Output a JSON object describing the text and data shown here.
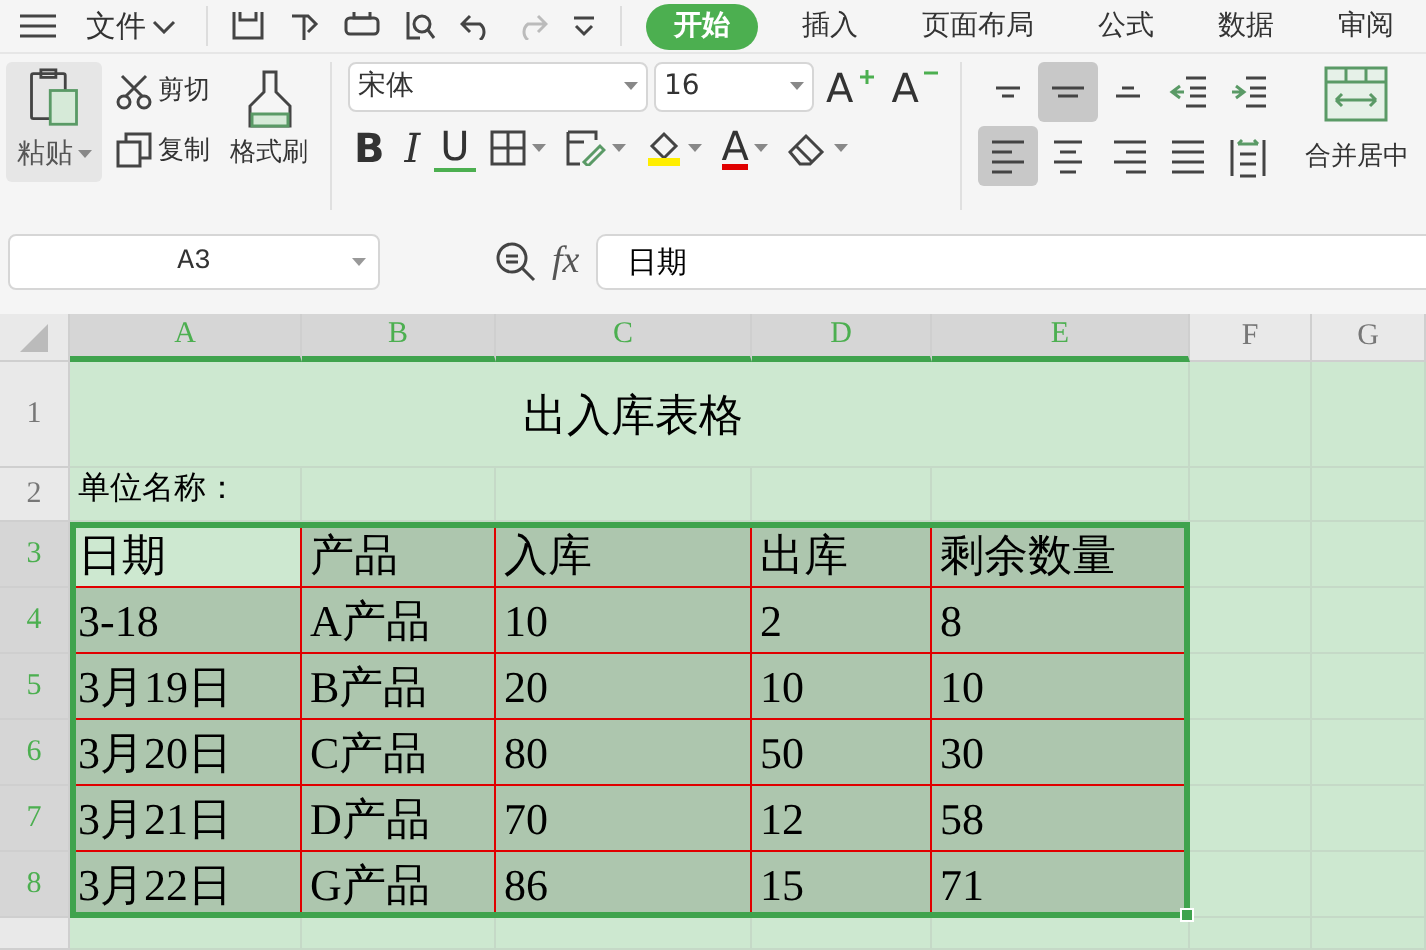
{
  "menu_bar": {
    "file_menu": "文件",
    "tabs": [
      {
        "label": "开始",
        "selected": true
      },
      {
        "label": "插入",
        "selected": false
      },
      {
        "label": "页面布局",
        "selected": false
      },
      {
        "label": "公式",
        "selected": false
      },
      {
        "label": "数据",
        "selected": false
      },
      {
        "label": "审阅",
        "selected": false
      }
    ]
  },
  "ribbon": {
    "paste": "粘贴",
    "cut": "剪切",
    "copy": "复制",
    "format_painter": "格式刷",
    "font_name": "宋体",
    "font_size": "16",
    "grow_font": "A",
    "shrink_font": "A",
    "bold": "B",
    "italic": "I",
    "underline": "U",
    "font_color": "A",
    "merge_center": "合并居中",
    "alignment": [
      {
        "kind": "top",
        "selected": false
      },
      {
        "kind": "middle",
        "selected": true
      },
      {
        "kind": "bottom",
        "selected": false
      },
      {
        "kind": "outdent",
        "selected": false
      },
      {
        "kind": "indent",
        "selected": false
      },
      {
        "kind": "left",
        "selected": true
      },
      {
        "kind": "center",
        "selected": false
      },
      {
        "kind": "right",
        "selected": false
      },
      {
        "kind": "justify",
        "selected": false
      },
      {
        "kind": "distributed",
        "selected": false
      }
    ]
  },
  "formula_bar": {
    "cell_ref": "A3",
    "fx": "fx",
    "value": "日期"
  },
  "sheet": {
    "columns": [
      {
        "label": "A",
        "selected": true
      },
      {
        "label": "B",
        "selected": true
      },
      {
        "label": "C",
        "selected": true
      },
      {
        "label": "D",
        "selected": true
      },
      {
        "label": "E",
        "selected": true
      },
      {
        "label": "F",
        "selected": false
      },
      {
        "label": "G",
        "selected": false
      }
    ],
    "rows": [
      {
        "label": "1",
        "kind": "title",
        "selected": false,
        "cells": [
          {
            "text": "出入库表格"
          }
        ]
      },
      {
        "label": "2",
        "kind": "label",
        "selected": false,
        "cells": [
          {
            "text": "单位名称："
          }
        ]
      },
      {
        "label": "3",
        "kind": "table",
        "selected": true,
        "cells": [
          {
            "text": "日期",
            "active": true
          },
          {
            "text": "产品",
            "active": false
          },
          {
            "text": "入库",
            "active": false
          },
          {
            "text": "出库",
            "active": false
          },
          {
            "text": "剩余数量",
            "active": false
          }
        ]
      },
      {
        "label": "4",
        "kind": "table",
        "selected": true,
        "cells": [
          {
            "text": "3-18",
            "active": false
          },
          {
            "text": "A产品",
            "active": false
          },
          {
            "text": "10",
            "active": false
          },
          {
            "text": "2",
            "active": false
          },
          {
            "text": "8",
            "active": false
          }
        ]
      },
      {
        "label": "5",
        "kind": "table",
        "selected": true,
        "cells": [
          {
            "text": "3月19日",
            "active": false
          },
          {
            "text": "B产品",
            "active": false
          },
          {
            "text": "20",
            "active": false
          },
          {
            "text": "10",
            "active": false
          },
          {
            "text": "10",
            "active": false
          }
        ]
      },
      {
        "label": "6",
        "kind": "table",
        "selected": true,
        "cells": [
          {
            "text": "3月20日",
            "active": false
          },
          {
            "text": "C产品",
            "active": false
          },
          {
            "text": "80",
            "active": false
          },
          {
            "text": "50",
            "active": false
          },
          {
            "text": "30",
            "active": false
          }
        ]
      },
      {
        "label": "7",
        "kind": "table",
        "selected": true,
        "cells": [
          {
            "text": "3月21日",
            "active": false
          },
          {
            "text": "D产品",
            "active": false
          },
          {
            "text": "70",
            "active": false
          },
          {
            "text": "12",
            "active": false
          },
          {
            "text": "58",
            "active": false
          }
        ]
      },
      {
        "label": "8",
        "kind": "table",
        "selected": true,
        "cells": [
          {
            "text": "3月22日",
            "active": false
          },
          {
            "text": "G产品",
            "active": false
          },
          {
            "text": "86",
            "active": false
          },
          {
            "text": "15",
            "active": false
          },
          {
            "text": "71",
            "active": false
          }
        ]
      }
    ]
  }
}
